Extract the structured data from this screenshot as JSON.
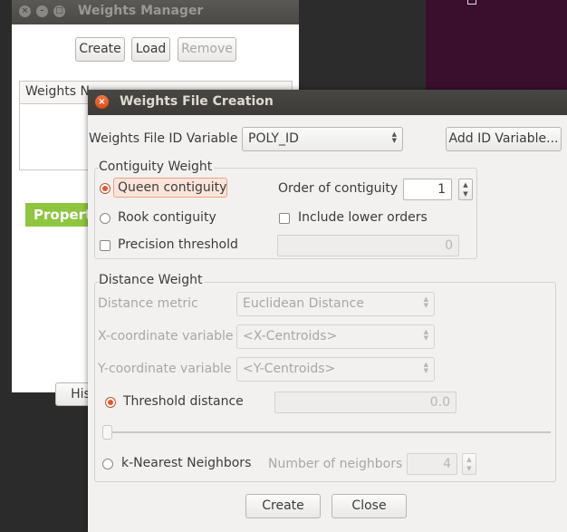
{
  "background_window": {
    "title": "Weights Manager",
    "create_label": "Create",
    "load_label": "Load",
    "remove_label": "Remove",
    "list_header": "Weights N",
    "properties_label": "Propert",
    "history_label": "Histo"
  },
  "dialog": {
    "title": "Weights File Creation",
    "id_variable_label": "Weights File ID Variable",
    "id_variable_value": "POLY_ID",
    "add_id_label": "Add ID Variable...",
    "contiguity": {
      "group_label": "Contiguity Weight",
      "queen_label": "Queen contiguity",
      "rook_label": "Rook contiguity",
      "precision_label": "Precision threshold",
      "order_label": "Order of contiguity",
      "order_value": "1",
      "include_lower_label": "Include lower orders",
      "precision_value": "0"
    },
    "distance": {
      "group_label": "Distance Weight",
      "metric_label": "Distance metric",
      "metric_value": "Euclidean Distance",
      "x_label": "X-coordinate variable",
      "x_value": "<X-Centroids>",
      "y_label": "Y-coordinate variable",
      "y_value": "<Y-Centroids>",
      "threshold_label": "Threshold distance",
      "threshold_value": "0.0",
      "knn_label": "k-Nearest Neighbors",
      "neighbors_label": "Number of neighbors",
      "neighbors_value": "4"
    },
    "create_label": "Create",
    "close_label": "Close"
  },
  "colors": {
    "accent": "#e05a2b",
    "green": "#8ec63f",
    "titlebar": "#3c3b37"
  }
}
